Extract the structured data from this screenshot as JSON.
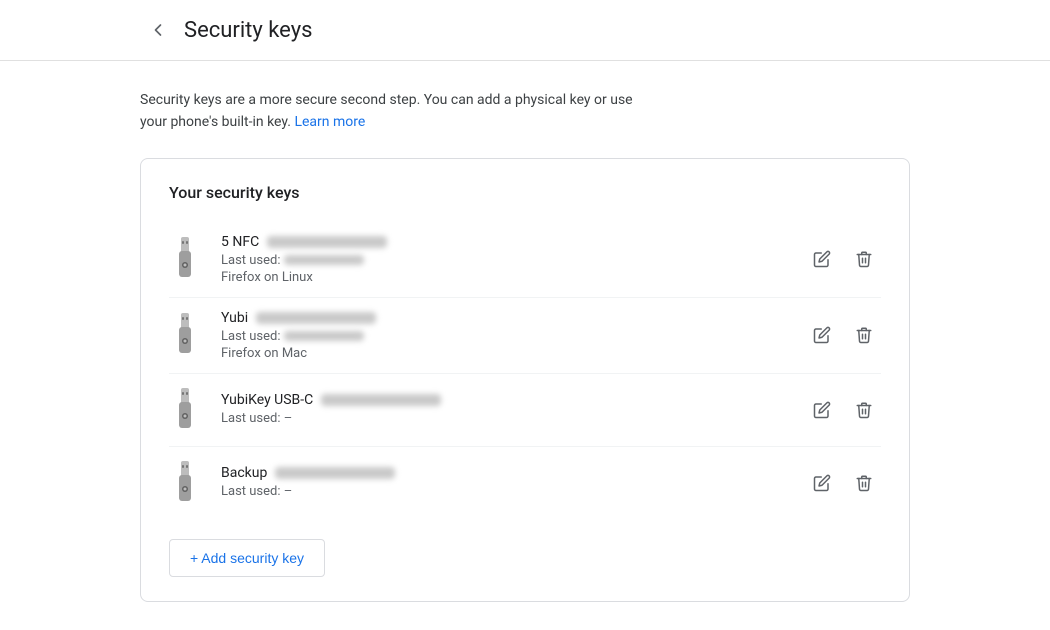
{
  "header": {
    "back_label": "←",
    "title": "Security keys"
  },
  "description": {
    "text": "Security keys are a more secure second step. You can add a physical key or use your phone's built-in key.",
    "learn_more_label": "Learn more"
  },
  "card": {
    "title": "Your security keys",
    "keys": [
      {
        "name": "5 NFC",
        "last_used_label": "Last used:",
        "last_used_blurred": true,
        "browser": "Firefox on Linux"
      },
      {
        "name": "Yubi",
        "last_used_label": "Last used:",
        "last_used_blurred": true,
        "browser": "Firefox on Mac"
      },
      {
        "name": "YubiKey USB-C",
        "last_used_label": "Last used:",
        "last_used_value": "–",
        "last_used_blurred": false,
        "browser": ""
      },
      {
        "name": "Backup",
        "last_used_label": "Last used:",
        "last_used_value": "–",
        "last_used_blurred": false,
        "browser": ""
      }
    ],
    "add_button_label": "+ Add security key"
  },
  "icons": {
    "edit": "✏",
    "delete": "🗑"
  }
}
